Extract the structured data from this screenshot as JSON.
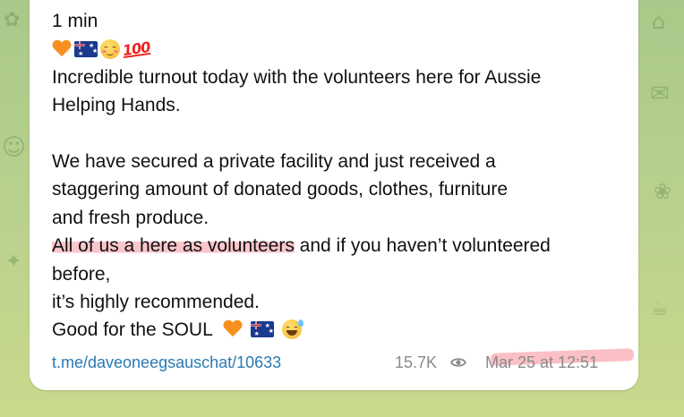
{
  "message": {
    "header": "1 min",
    "lead_emojis": [
      "orange-heart",
      "australia-flag",
      "smiling-face",
      "hundred-points"
    ],
    "paragraph1": [
      "Incredible turnout today with the volunteers here for Aussie",
      "Helping Hands."
    ],
    "paragraph2": [
      "We have secured a private facility and just received a",
      "staggering amount of donated goods, clothes, furniture",
      "and fresh produce."
    ],
    "highlighted_text": "All of us a here as volunteers",
    "after_highlight": " and if you haven’t volunteered",
    "line_before": "before,",
    "line_recommended": "it’s highly recommended.",
    "closing": "Good for the SOUL",
    "closing_emojis": [
      "orange-heart",
      "australia-flag",
      "grinning-sweat-face"
    ]
  },
  "footer": {
    "link": "t.me/daveoneegsauschat/10633",
    "views": "15.7K",
    "timestamp": "Mar 25 at 12:51"
  },
  "colors": {
    "link": "#2a7ab5",
    "highlight": "#f596a0",
    "wallpaper": "#b7d08e"
  }
}
